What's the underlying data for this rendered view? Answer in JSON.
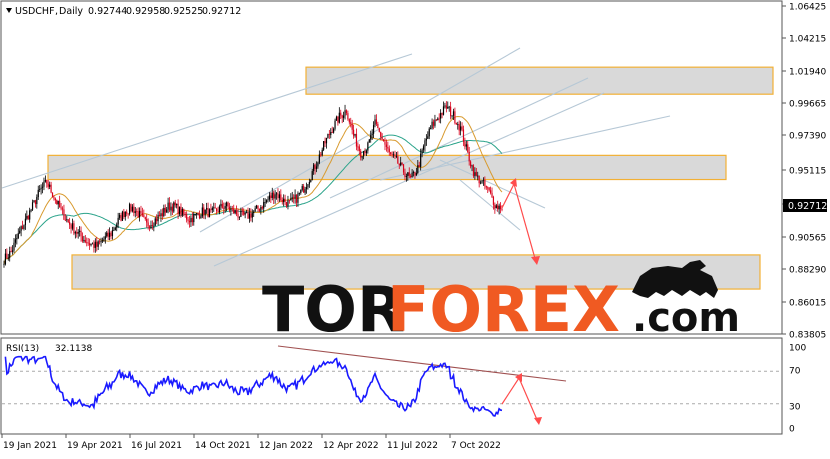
{
  "chart_data": [
    {
      "type": "candlestick",
      "symbol": "USDCHF",
      "timeframe": "Daily",
      "ohlc": {
        "open": "0.92744",
        "high": "0.92958",
        "low": "0.92525",
        "close": "0.92712"
      },
      "last_price": "0.92712",
      "y_ticks": [
        "1.06425",
        "1.04215",
        "1.01940",
        "0.99665",
        "0.97390",
        "0.95115",
        "0.92840",
        "0.90565",
        "0.88290",
        "0.86015",
        "0.83805"
      ],
      "x_ticks": [
        "19 Jan 2021",
        "19 Apr 2021",
        "16 Jul 2021",
        "14 Oct 2021",
        "12 Jan 2022",
        "12 Apr 2022",
        "11 Jul 2022",
        "7 Oct 2022"
      ],
      "ylim": [
        0.834,
        1.066
      ],
      "close_path": [
        [
          0,
          0.888
        ],
        [
          5,
          0.893
        ],
        [
          10,
          0.905
        ],
        [
          15,
          0.915
        ],
        [
          20,
          0.925
        ],
        [
          25,
          0.936
        ],
        [
          30,
          0.942
        ],
        [
          35,
          0.932
        ],
        [
          40,
          0.922
        ],
        [
          45,
          0.914
        ],
        [
          50,
          0.908
        ],
        [
          55,
          0.903
        ],
        [
          60,
          0.899
        ],
        [
          65,
          0.897
        ],
        [
          70,
          0.902
        ],
        [
          75,
          0.906
        ],
        [
          80,
          0.915
        ],
        [
          85,
          0.922
        ],
        [
          90,
          0.924
        ],
        [
          95,
          0.919
        ],
        [
          100,
          0.912
        ],
        [
          105,
          0.915
        ],
        [
          110,
          0.919
        ],
        [
          115,
          0.925
        ],
        [
          120,
          0.925
        ],
        [
          125,
          0.92
        ],
        [
          130,
          0.916
        ],
        [
          135,
          0.919
        ],
        [
          140,
          0.922
        ],
        [
          145,
          0.92
        ],
        [
          150,
          0.923
        ],
        [
          155,
          0.926
        ],
        [
          160,
          0.922
        ],
        [
          165,
          0.919
        ],
        [
          170,
          0.918
        ],
        [
          175,
          0.921
        ],
        [
          180,
          0.925
        ],
        [
          185,
          0.93
        ],
        [
          190,
          0.935
        ],
        [
          195,
          0.93
        ],
        [
          200,
          0.927
        ],
        [
          205,
          0.931
        ],
        [
          210,
          0.938
        ],
        [
          215,
          0.947
        ],
        [
          220,
          0.958
        ],
        [
          225,
          0.97
        ],
        [
          230,
          0.98
        ],
        [
          235,
          0.988
        ],
        [
          240,
          0.993
        ],
        [
          245,
          0.975
        ],
        [
          250,
          0.963
        ],
        [
          255,
          0.967
        ],
        [
          260,
          0.983
        ],
        [
          265,
          0.973
        ],
        [
          270,
          0.962
        ],
        [
          275,
          0.957
        ],
        [
          280,
          0.95
        ],
        [
          285,
          0.944
        ],
        [
          290,
          0.952
        ],
        [
          295,
          0.97
        ],
        [
          300,
          0.982
        ],
        [
          305,
          0.989
        ],
        [
          310,
          0.995
        ],
        [
          315,
          0.989
        ],
        [
          320,
          0.98
        ],
        [
          325,
          0.962
        ],
        [
          330,
          0.947
        ],
        [
          335,
          0.942
        ],
        [
          340,
          0.935
        ],
        [
          345,
          0.925
        ]
      ],
      "resistance_zone": [
        1.004,
        1.023
      ],
      "middle_zone": [
        0.944,
        0.961
      ],
      "support_zone": [
        0.867,
        0.891
      ]
    },
    {
      "type": "line",
      "indicator": "RSI(13)",
      "value": "32.1138",
      "y_ticks": [
        "100",
        "70",
        "30",
        "0"
      ],
      "levels": [
        70,
        30
      ],
      "ylim": [
        0,
        100
      ]
    }
  ],
  "watermark": {
    "part1": "TOR",
    "part2": "FOREX",
    "suffix": ".com"
  },
  "colors": {
    "bull": "#000000",
    "bear": "#d8001a",
    "rsi": "#1a1aff",
    "ma_fast": "#d89a2e",
    "ma_slow": "#2aa38a",
    "zone_fill": "#d9d9d9",
    "zone_border": "#f2b035",
    "trend": "#b6c8d6",
    "forecast": "#ff4c4c",
    "tor": "#111111",
    "forex": "#f05a22"
  }
}
